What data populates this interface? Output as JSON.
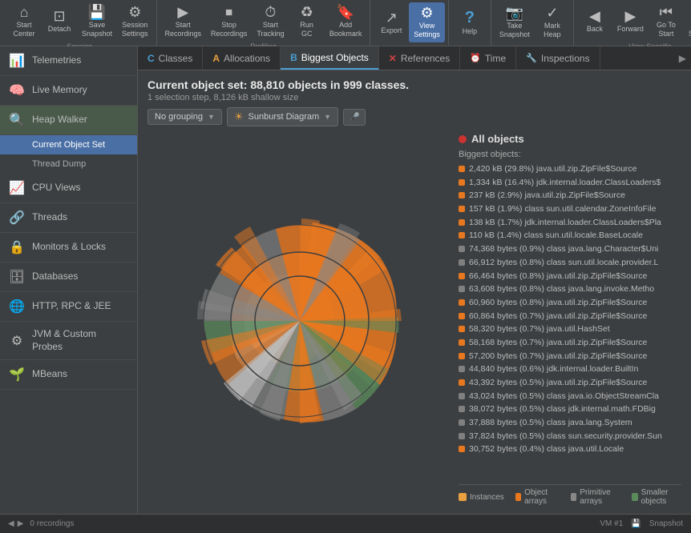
{
  "toolbar": {
    "groups": [
      {
        "id": "session",
        "label": "Session",
        "buttons": [
          {
            "id": "start-center",
            "icon": "⌂",
            "label": "Start\nCenter",
            "active": false
          },
          {
            "id": "detach",
            "icon": "⊡",
            "label": "Detach",
            "active": false
          },
          {
            "id": "save-snapshot",
            "icon": "💾",
            "label": "Save\nSnapshot",
            "active": false
          },
          {
            "id": "session-settings",
            "icon": "⚙",
            "label": "Session\nSettings",
            "active": false
          }
        ]
      },
      {
        "id": "recordings",
        "label": "Profiling",
        "buttons": [
          {
            "id": "start-recordings",
            "icon": "▶",
            "label": "Start\nRecordings",
            "active": false
          },
          {
            "id": "stop-recordings",
            "icon": "⏹",
            "label": "Stop\nRecordings",
            "active": false
          },
          {
            "id": "start-tracking",
            "icon": "⏱",
            "label": "Start\nTracking",
            "active": false
          },
          {
            "id": "run-gc",
            "icon": "♻",
            "label": "Run GC",
            "active": false
          },
          {
            "id": "add-bookmark",
            "icon": "🔖",
            "label": "Add\nBookmark",
            "active": false
          }
        ]
      },
      {
        "id": "export-view",
        "label": "",
        "buttons": [
          {
            "id": "export",
            "icon": "↗",
            "label": "Export",
            "active": false
          },
          {
            "id": "view-settings",
            "icon": "⚙",
            "label": "View\nSettings",
            "active": true
          }
        ]
      },
      {
        "id": "help",
        "label": "",
        "buttons": [
          {
            "id": "help",
            "icon": "?",
            "label": "Help",
            "active": false
          }
        ]
      },
      {
        "id": "snapshot",
        "label": "",
        "buttons": [
          {
            "id": "take-snapshot",
            "icon": "📷",
            "label": "Take\nSnapshot",
            "active": false
          },
          {
            "id": "mark-heap",
            "icon": "✓",
            "label": "Mark\nHeap",
            "active": false
          }
        ]
      },
      {
        "id": "navigation",
        "label": "View Specific",
        "buttons": [
          {
            "id": "back",
            "icon": "◀",
            "label": "Back",
            "active": false
          },
          {
            "id": "forward",
            "icon": "▶",
            "label": "Forward",
            "active": false
          },
          {
            "id": "go-to-start",
            "icon": "⏮",
            "label": "Go To\nStart",
            "active": false
          },
          {
            "id": "show-selection",
            "icon": "⊞",
            "label": "Show\nSelection",
            "active": false
          }
        ]
      }
    ]
  },
  "sidebar": {
    "items": [
      {
        "id": "telemetries",
        "icon": "📊",
        "label": "Telemetries",
        "active": false
      },
      {
        "id": "live-memory",
        "icon": "🧠",
        "label": "Live Memory",
        "active": false
      },
      {
        "id": "heap-walker",
        "icon": "🔍",
        "label": "Heap Walker",
        "active": true
      },
      {
        "id": "current-object-set",
        "label": "Current Object Set",
        "sub": true,
        "active": true
      },
      {
        "id": "thread-dump",
        "label": "Thread Dump",
        "sub": true,
        "active": false
      },
      {
        "id": "cpu-views",
        "icon": "📈",
        "label": "CPU Views",
        "active": false
      },
      {
        "id": "threads",
        "icon": "🔗",
        "label": "Threads",
        "active": false
      },
      {
        "id": "monitors-locks",
        "icon": "🔒",
        "label": "Monitors & Locks",
        "active": false
      },
      {
        "id": "databases",
        "icon": "🗄",
        "label": "Databases",
        "active": false
      },
      {
        "id": "http-rpc-jee",
        "icon": "🌐",
        "label": "HTTP, RPC & JEE",
        "active": false
      },
      {
        "id": "jvm-custom",
        "icon": "⚙",
        "label": "JVM & Custom Probes",
        "active": false
      },
      {
        "id": "mbeans",
        "icon": "🌱",
        "label": "MBeans",
        "active": false
      }
    ]
  },
  "tabs": [
    {
      "id": "classes",
      "icon": "C",
      "label": "Classes",
      "active": false,
      "iconColor": "#4a9fd4"
    },
    {
      "id": "allocations",
      "icon": "A",
      "label": "Allocations",
      "active": false,
      "iconColor": "#e8a040"
    },
    {
      "id": "biggest-objects",
      "icon": "B",
      "label": "Biggest Objects",
      "active": true,
      "iconColor": "#4a9fd4"
    },
    {
      "id": "references",
      "icon": "R",
      "label": "References",
      "active": false,
      "iconColor": "#cc4444"
    },
    {
      "id": "time",
      "icon": "⏰",
      "label": "Time",
      "active": false
    },
    {
      "id": "inspections",
      "icon": "🔧",
      "label": "Inspections",
      "active": false
    }
  ],
  "content": {
    "object_set_prefix": "Current object set:",
    "object_set_title": "88,810 objects in 999 classes.",
    "object_set_subtitle": "1 selection step, 8,126 kB shallow size",
    "grouping_label": "No grouping",
    "diagram_label": "Sunburst Diagram"
  },
  "biggest_objects": {
    "header": "All objects",
    "section_label": "Biggest objects:",
    "items": [
      {
        "color": "#e87820",
        "text": "2,420 kB (29.8%) java.util.zip.ZipFile$Source"
      },
      {
        "color": "#e87820",
        "text": "1,334 kB (16.4%) jdk.internal.loader.ClassLoaders$"
      },
      {
        "color": "#e87820",
        "text": "237 kB (2.9%) java.util.zip.ZipFile$Source"
      },
      {
        "color": "#e87820",
        "text": "157 kB (1.9%) class sun.util.calendar.ZoneInfoFile"
      },
      {
        "color": "#e87820",
        "text": "138 kB (1.7%) jdk.internal.loader.ClassLoaders$Pla"
      },
      {
        "color": "#e87820",
        "text": "110 kB (1.4%) class sun.util.locale.BaseLocale"
      },
      {
        "color": "#808080",
        "text": "74,368 bytes (0.9%) class java.lang.Character$Uni"
      },
      {
        "color": "#808080",
        "text": "66,912 bytes (0.8%) class sun.util.locale.provider.L"
      },
      {
        "color": "#e87820",
        "text": "66,464 bytes (0.8%) java.util.zip.ZipFile$Source"
      },
      {
        "color": "#808080",
        "text": "63,608 bytes (0.8%) class java.lang.invoke.Metho"
      },
      {
        "color": "#e87820",
        "text": "60,960 bytes (0.8%) java.util.zip.ZipFile$Source"
      },
      {
        "color": "#e87820",
        "text": "60,864 bytes (0.7%) java.util.zip.ZipFile$Source"
      },
      {
        "color": "#e87820",
        "text": "58,320 bytes (0.7%) java.util.HashSet"
      },
      {
        "color": "#e87820",
        "text": "58,168 bytes (0.7%) java.util.zip.ZipFile$Source"
      },
      {
        "color": "#e87820",
        "text": "57,200 bytes (0.7%) java.util.zip.ZipFile$Source"
      },
      {
        "color": "#808080",
        "text": "44,840 bytes (0.6%) jdk.internal.loader.BuiltIn"
      },
      {
        "color": "#e87820",
        "text": "43,392 bytes (0.5%) java.util.zip.ZipFile$Source"
      },
      {
        "color": "#808080",
        "text": "43,024 bytes (0.5%) class java.io.ObjectStreamCla"
      },
      {
        "color": "#808080",
        "text": "38,072 bytes (0.5%) class jdk.internal.math.FDBig"
      },
      {
        "color": "#808080",
        "text": "37,888 bytes (0.5%) class java.lang.System"
      },
      {
        "color": "#808080",
        "text": "37,824 bytes (0.5%) class sun.security.provider.Sun"
      },
      {
        "color": "#e87820",
        "text": "30,752 bytes (0.4%) class java.util.Locale"
      }
    ]
  },
  "legend": [
    {
      "color": "#e8a040",
      "label": "Instances"
    },
    {
      "color": "#e87820",
      "label": "Object arrays"
    },
    {
      "color": "#888",
      "label": "Primitive arrays"
    },
    {
      "color": "#5a8a5a",
      "label": "Smaller objects"
    }
  ],
  "status_bar": {
    "recordings": "0 recordings",
    "vm": "VM #1",
    "snapshot": "Snapshot"
  }
}
